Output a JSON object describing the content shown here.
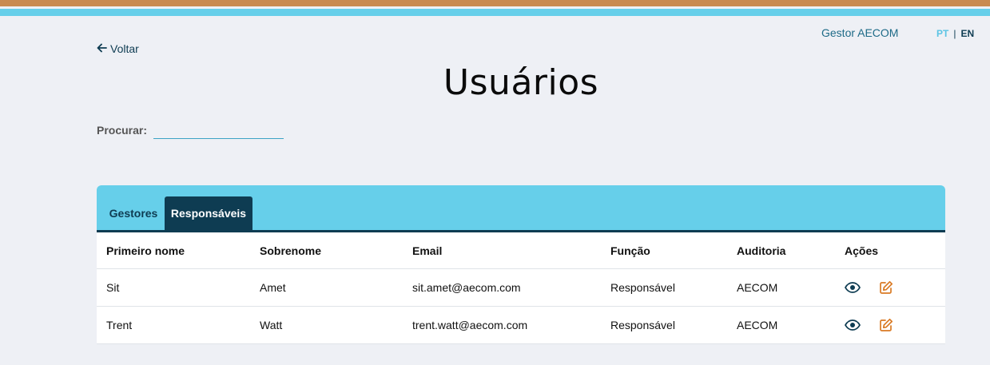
{
  "header": {
    "user_name": "Gestor AECOM",
    "lang_pt": "PT",
    "lang_sep": "|",
    "lang_en": "EN"
  },
  "nav": {
    "back_label": "Voltar"
  },
  "page": {
    "title": "Usuários"
  },
  "search": {
    "label": "Procurar:",
    "value": ""
  },
  "tabs": [
    {
      "label": "Gestores",
      "active": false
    },
    {
      "label": "Responsáveis",
      "active": true
    }
  ],
  "table": {
    "columns": [
      "Primeiro nome",
      "Sobrenome",
      "Email",
      "Função",
      "Auditoria",
      "Ações"
    ],
    "rows": [
      {
        "first": "Sit",
        "last": "Amet",
        "email": "sit.amet@aecom.com",
        "role": "Responsável",
        "audit": "AECOM"
      },
      {
        "first": "Trent",
        "last": "Watt",
        "email": "trent.watt@aecom.com",
        "role": "Responsável",
        "audit": "AECOM"
      }
    ],
    "action_icons": [
      "eye-icon",
      "edit-icon"
    ]
  },
  "colors": {
    "accent_blue": "#66cfea",
    "dark_navy": "#0e3c52",
    "orange": "#c98a50",
    "edit_orange": "#d97a24"
  }
}
